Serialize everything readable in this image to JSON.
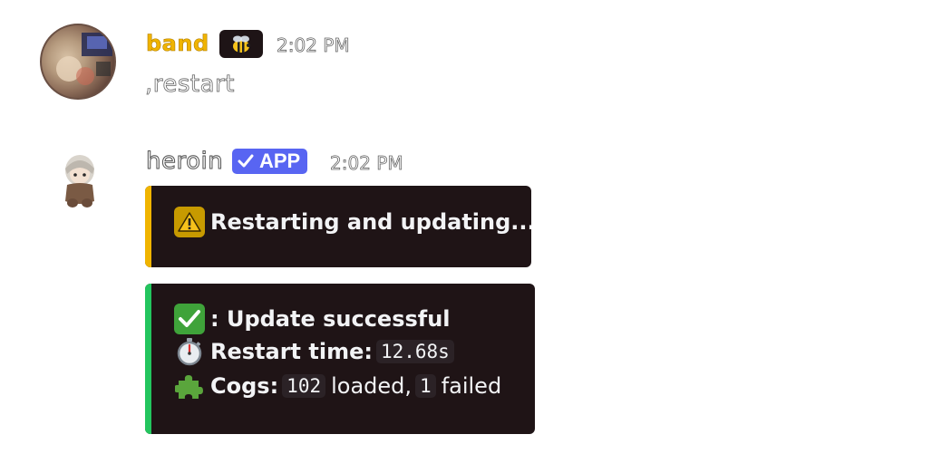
{
  "messages": [
    {
      "username": "band",
      "username_color": "#f0b400",
      "role_icon": "bee-icon",
      "timestamp": "2:02 PM",
      "content": ",restart"
    },
    {
      "username": "heroin",
      "app_badge": "APP",
      "timestamp": "2:02 PM",
      "embeds": [
        {
          "bar_color": "#f0b400",
          "icon": "warning-icon",
          "title": "Restarting and updating..."
        },
        {
          "bar_color": "#23c55e",
          "lines": {
            "status_icon": "check-mark-icon",
            "status_text": ": Update successful",
            "time_icon": "stopwatch-icon",
            "time_label": "Restart time:",
            "time_value": "12.68s",
            "cogs_icon": "puzzle-piece-icon",
            "cogs_label": "Cogs:",
            "cogs_loaded": "102",
            "cogs_loaded_text": "loaded,",
            "cogs_failed": "1",
            "cogs_failed_text": "failed"
          }
        }
      ]
    }
  ]
}
